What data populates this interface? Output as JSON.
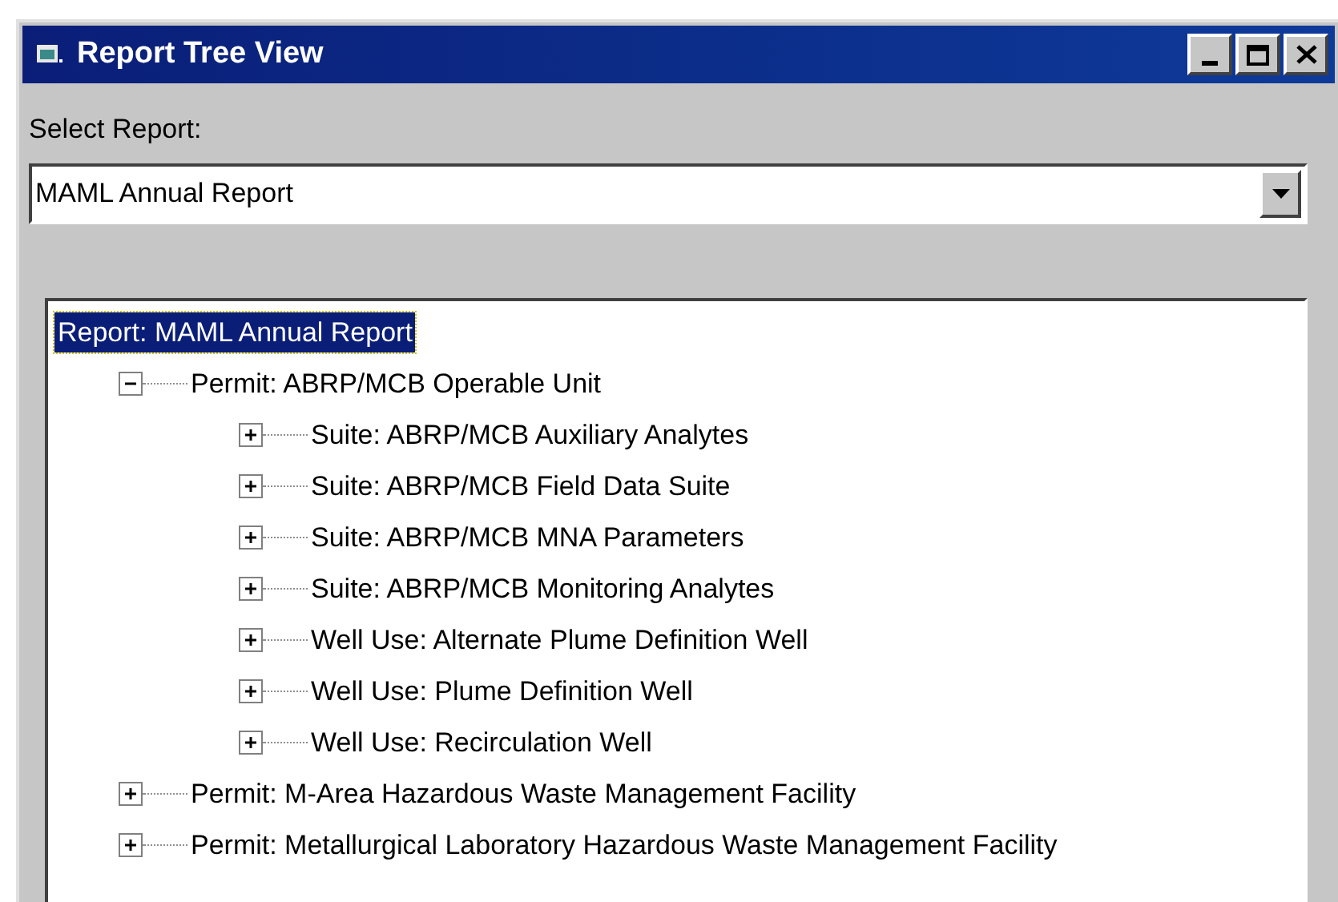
{
  "window": {
    "title": "Report Tree View"
  },
  "select_report": {
    "label": "Select Report:",
    "value": "MAML Annual Report"
  },
  "tree": [
    {
      "label": "Report: MAML Annual Report",
      "selected": true,
      "children": [
        {
          "label": "Permit: ABRP/MCB Operable Unit",
          "selected": false,
          "expanded": true,
          "children": [
            {
              "label": "Suite: ABRP/MCB Auxiliary Analytes",
              "selected": false,
              "expanded": false
            },
            {
              "label": "Suite: ABRP/MCB Field Data Suite",
              "selected": false,
              "expanded": false
            },
            {
              "label": "Suite: ABRP/MCB MNA Parameters",
              "selected": false,
              "expanded": false
            },
            {
              "label": "Suite: ABRP/MCB Monitoring Analytes",
              "selected": false,
              "expanded": false
            },
            {
              "label": "Well Use: Alternate Plume Definition Well",
              "selected": false,
              "expanded": false
            },
            {
              "label": "Well Use: Plume Definition Well",
              "selected": false,
              "expanded": false
            },
            {
              "label": "Well Use: Recirculation Well",
              "selected": false,
              "expanded": false
            }
          ]
        },
        {
          "label": "Permit: M-Area Hazardous Waste Management Facility",
          "selected": false,
          "expanded": false
        },
        {
          "label": "Permit: Metallurgical Laboratory Hazardous Waste Management Facility",
          "selected": false,
          "expanded": false
        }
      ]
    }
  ]
}
